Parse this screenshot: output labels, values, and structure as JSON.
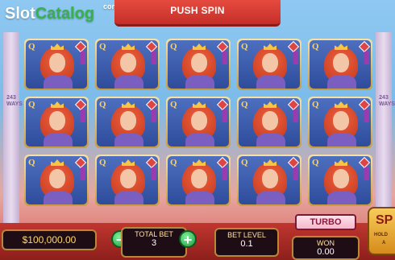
{
  "header": {
    "logo_main": "Slot",
    "logo_accent": "Catalog",
    "logo_suffix": "com",
    "banner_text": "PUSH SPIN"
  },
  "side_labels": {
    "left": "243 WAYS",
    "right": "243 WAYS"
  },
  "reels": {
    "rows": 3,
    "cols": 5,
    "symbol": "Q"
  },
  "footer": {
    "balance": "$100,000.00",
    "total_bet_label": "TOTAL BET",
    "total_bet_value": "3",
    "minus_label": "−",
    "plus_label": "+",
    "bet_level_label": "BET LEVEL",
    "bet_level_value": "0.1",
    "turbo_label": "TURBO",
    "won_label": "WON",
    "won_value": "0.00",
    "spin_letter": "SP",
    "spin_hold": "HOLD",
    "spin_auto": "A"
  }
}
